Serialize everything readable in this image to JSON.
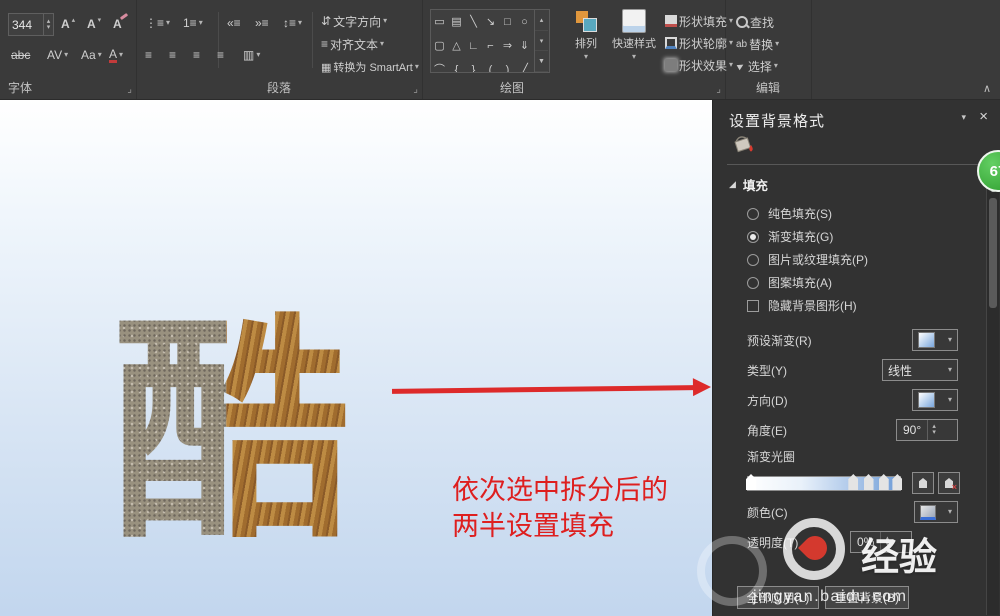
{
  "colors": {
    "accent_red": "#dd2a2a",
    "ribbon_bg": "#3a3a3a",
    "pane_bg": "#323232",
    "slide_top": "#ffffff",
    "slide_bottom": "#c2d6ee",
    "badge_green": "#2f9e2f"
  },
  "icons": {
    "chevron_down": "▾",
    "chevron_up": "▴",
    "close": "×",
    "collapse_ribbon": "∧",
    "section_expanded": "◢",
    "launcher": "⌟",
    "bullets": "⋮≡",
    "numbering": "1≡",
    "indent_decrease": "«≡",
    "indent_increase": "»≡",
    "line_spacing": "↕≡",
    "align_left": "≡",
    "align_center": "≡",
    "align_right": "≡",
    "align_justify": "≡",
    "columns": "▥",
    "text_direction": "⇵",
    "align_text_icon": "≡",
    "smartart": "▦",
    "grow_font": "A",
    "shrink_font": "A",
    "clear_format": "A",
    "strike_text": "abc",
    "spacing_text": "AV",
    "case_text": "Aa",
    "fontcolor_text": "A",
    "replace_text": "ab",
    "select_arrow": "►",
    "more": "▼",
    "scroll_up": "▴",
    "scroll_down": "▾"
  },
  "ribbon": {
    "font": {
      "label": "字体",
      "size_value": "344"
    },
    "paragraph": {
      "label": "段落",
      "text_direction": "文字方向",
      "align_text": "对齐文本",
      "smartart": "转换为 SmartArt"
    },
    "drawing": {
      "label": "绘图",
      "arrange": "排列",
      "quick_styles": "快速样式",
      "shape_fill": "形状填充",
      "shape_outline": "形状轮廓",
      "shape_effects": "形状效果",
      "shapes_row1": [
        "▭",
        "▤",
        "╲",
        "↘",
        "□",
        "○"
      ],
      "shapes_row2": [
        "▢",
        "△",
        "∟",
        "⌐",
        "⇒",
        "⇓"
      ],
      "shapes_row3": [
        "⌒",
        "{",
        "}",
        "(",
        ")",
        "╱"
      ]
    },
    "editing": {
      "label": "编辑",
      "find": "查找",
      "replace": "替换",
      "select": "选择"
    }
  },
  "slide": {
    "big_char": "酷",
    "annotation_line1": "依次选中拆分后的",
    "annotation_line2": "两半设置填充"
  },
  "pane": {
    "title": "设置背景格式",
    "section_fill": "填充",
    "options": [
      {
        "label": "纯色填充(S)",
        "selected": false
      },
      {
        "label": "渐变填充(G)",
        "selected": true
      },
      {
        "label": "图片或纹理填充(P)",
        "selected": false
      },
      {
        "label": "图案填充(A)",
        "selected": false
      }
    ],
    "checkbox_hide": "隐藏背景图形(H)",
    "preset_label": "预设渐变(R)",
    "type_label": "类型(Y)",
    "type_value": "线性",
    "direction_label": "方向(D)",
    "angle_label": "角度(E)",
    "angle_value": "90°",
    "stops_label": "渐变光圈",
    "color_label": "颜色(C)",
    "transparency_label": "透明度(T)",
    "transparency_value": "0%",
    "apply_all": "全部应用(L)",
    "reset": "重置背景(B)"
  },
  "watermark": {
    "badge": "67",
    "brand": "经验",
    "url": "jingyan.baidu.com"
  }
}
